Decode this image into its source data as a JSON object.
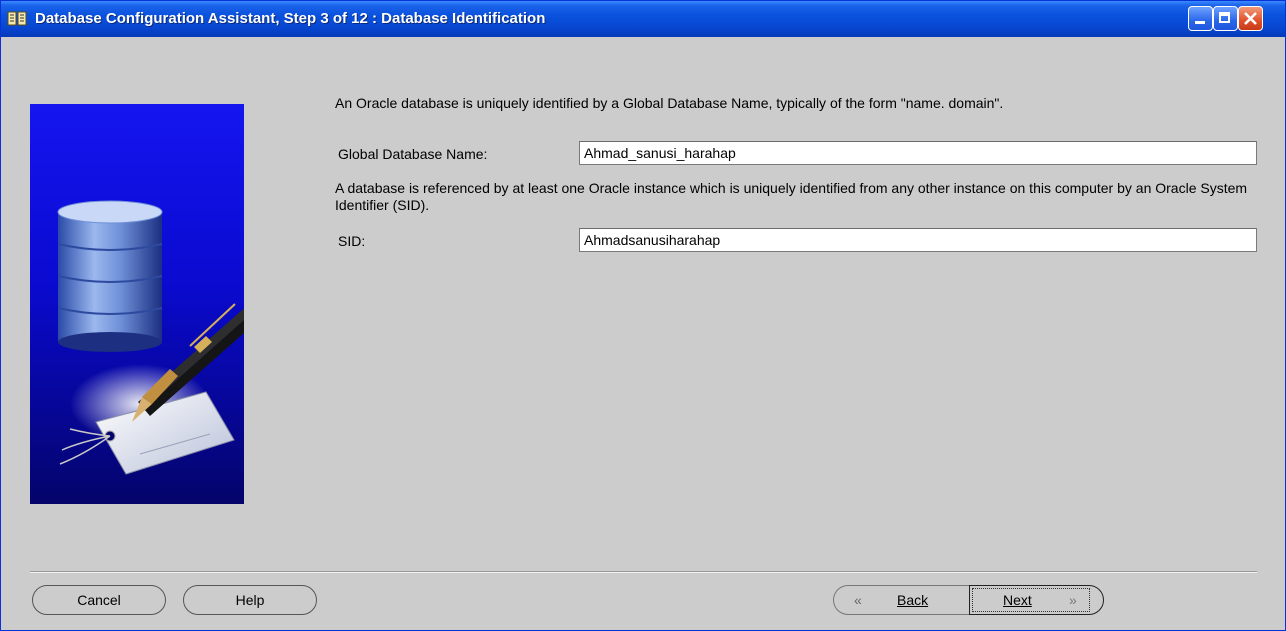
{
  "window": {
    "title": "Database Configuration Assistant, Step 3 of 12 : Database Identification",
    "icon": "database-app-icon",
    "controls": {
      "minimize": "minimize-icon",
      "maximize": "maximize-icon",
      "close": "close-icon"
    },
    "colors": {
      "titlebar": "#0a52de",
      "close": "#e0502a",
      "background": "#cccccc"
    }
  },
  "main": {
    "intro_text": "An Oracle database is uniquely identified by a Global Database Name, typically of the form \"name. domain\".",
    "global_db_name": {
      "label": "Global Database Name:",
      "value": "Ahmad_sanusi_harahap"
    },
    "sid_text": "A database is referenced by at least one Oracle instance which is uniquely identified from any other instance on this computer by an Oracle System Identifier (SID).",
    "sid": {
      "label": "SID:",
      "value": "Ahmadsanusiharahap"
    },
    "side_image": "database-pen-illustration"
  },
  "footer": {
    "cancel_label": "Cancel",
    "help_label": "Help",
    "back_label": "Back",
    "next_label": "Next",
    "back_arrow": "«",
    "next_arrow": "»"
  }
}
